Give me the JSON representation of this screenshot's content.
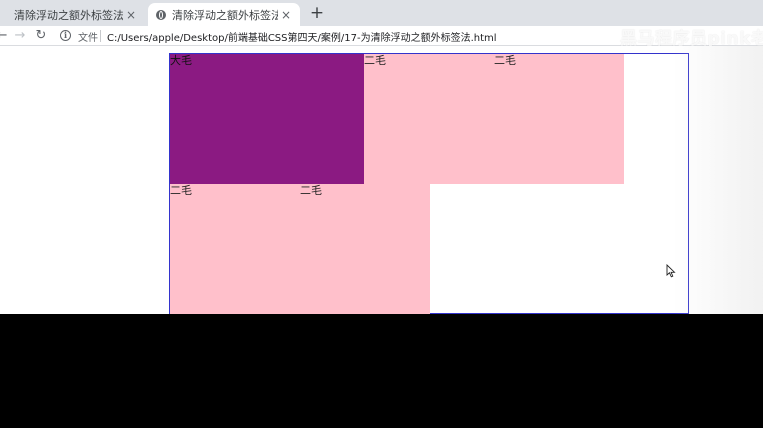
{
  "browser": {
    "tabs": [
      {
        "title": "清除浮动之额外标签法",
        "close": "×"
      },
      {
        "title": "清除浮动之额外标签法",
        "close": "×"
      }
    ],
    "new_tab": "+",
    "nav": {
      "back": "←",
      "forward": "→",
      "reload": "↻"
    },
    "address": {
      "info_icon": "i",
      "file_label": "文件",
      "url": "C:/Users/apple/Desktop/前端基础CSS第四天/案例/17-为清除浮动之额外标签法.html"
    }
  },
  "watermark": "黑马程序员pink老",
  "page": {
    "big_box": "大毛",
    "boxes": [
      "二毛",
      "二毛",
      "二毛",
      "二毛"
    ]
  },
  "colors": {
    "big_box": "#8b1a82",
    "small_box": "#ffc0cb",
    "container_border": "#3333cc"
  }
}
